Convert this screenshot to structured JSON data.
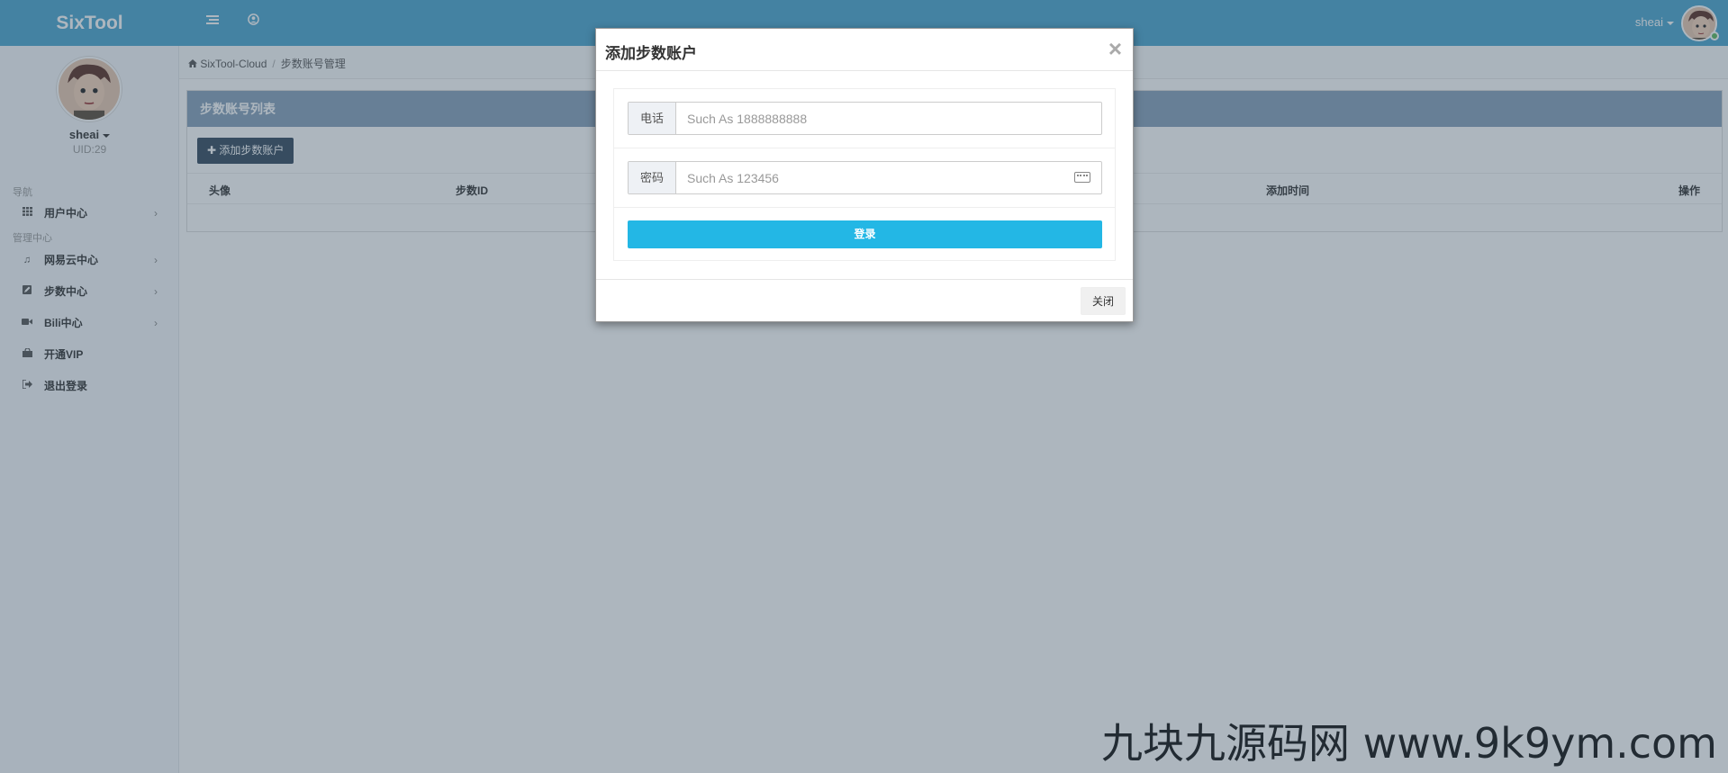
{
  "app": {
    "brand": "SixTool"
  },
  "header": {
    "menu_icon": "list-icon",
    "user_icon": "user-circle-icon",
    "username": "sheai"
  },
  "sidebar": {
    "username": "sheai",
    "uid": "UID:29",
    "sections": {
      "nav": "导航",
      "admin": "管理中心"
    },
    "items": [
      {
        "label": "用户中心",
        "icon": "grid-icon",
        "arrow": "›"
      },
      {
        "label": "网易云中心",
        "icon": "music-icon",
        "arrow": "›"
      },
      {
        "label": "步数中心",
        "icon": "edit-icon",
        "arrow": "›"
      },
      {
        "label": "Bili中心",
        "icon": "video-icon",
        "arrow": "›"
      },
      {
        "label": "开通VIP",
        "icon": "shopping-bag-icon"
      },
      {
        "label": "退出登录",
        "icon": "logout-icon"
      }
    ]
  },
  "breadcrumb": {
    "home": "SixTool-Cloud",
    "separator": "/",
    "current": "步数账号管理"
  },
  "panel": {
    "title": "步数账号列表",
    "add_button": "添加步数账户",
    "columns": [
      "头像",
      "步数ID",
      "添加时间",
      "操作"
    ]
  },
  "modal": {
    "title": "添加步数账户",
    "close_symbol": "×",
    "phone_label": "电话",
    "phone_placeholder": "Such As 1888888888",
    "password_label": "密码",
    "password_placeholder": "Such As 123456",
    "login_button": "登录",
    "close_button": "关闭"
  },
  "watermark": "九块九源码网 www.9k9ym.com",
  "colors": {
    "header": "#4ba5cf",
    "panel_head": "#87a1ba",
    "primary": "#23b7e5",
    "dark_button": "#34495e"
  }
}
